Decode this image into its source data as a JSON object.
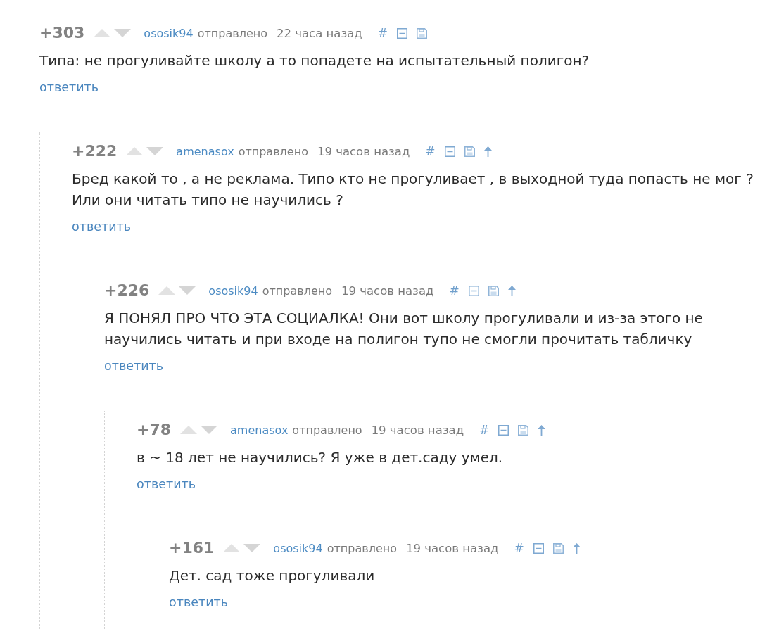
{
  "comments": [
    {
      "rating": "+303",
      "author": "ososik94",
      "sent_label": "отправлено",
      "time": "22 часа назад",
      "anchor": "#",
      "parent_link": false,
      "text": "Типа: не прогуливайте школу а то попадете на испытательный полигон?",
      "reply": "ответить",
      "children": [
        {
          "rating": "+222",
          "author": "amenasox",
          "sent_label": "отправлено",
          "time": "19 часов назад",
          "anchor": "#",
          "parent_link": true,
          "text": "Бред какой то , а не реклама. Типо кто не прогуливает , в выходной туда попасть не мог ? Или они читать типо не научились ?",
          "reply": "ответить",
          "children": [
            {
              "rating": "+226",
              "author": "ososik94",
              "sent_label": "отправлено",
              "time": "19 часов назад",
              "anchor": "#",
              "parent_link": true,
              "text": "Я ПОНЯЛ ПРО ЧТО ЭТА СОЦИАЛКА! Они вот школу прогуливали и из-за этого не научились читать и при входе на полигон тупо не смогли прочитать табличку",
              "reply": "ответить",
              "children": [
                {
                  "rating": "+78",
                  "author": "amenasox",
                  "sent_label": "отправлено",
                  "time": "19 часов назад",
                  "anchor": "#",
                  "parent_link": true,
                  "text": "в ~ 18 лет не научились? Я уже в дет.саду умел.",
                  "reply": "ответить",
                  "children": [
                    {
                      "rating": "+161",
                      "author": "ososik94",
                      "sent_label": "отправлено",
                      "time": "19 часов назад",
                      "anchor": "#",
                      "parent_link": true,
                      "text": "Дет. сад тоже прогуливали",
                      "reply": "ответить"
                    }
                  ]
                }
              ]
            }
          ]
        }
      ]
    }
  ]
}
